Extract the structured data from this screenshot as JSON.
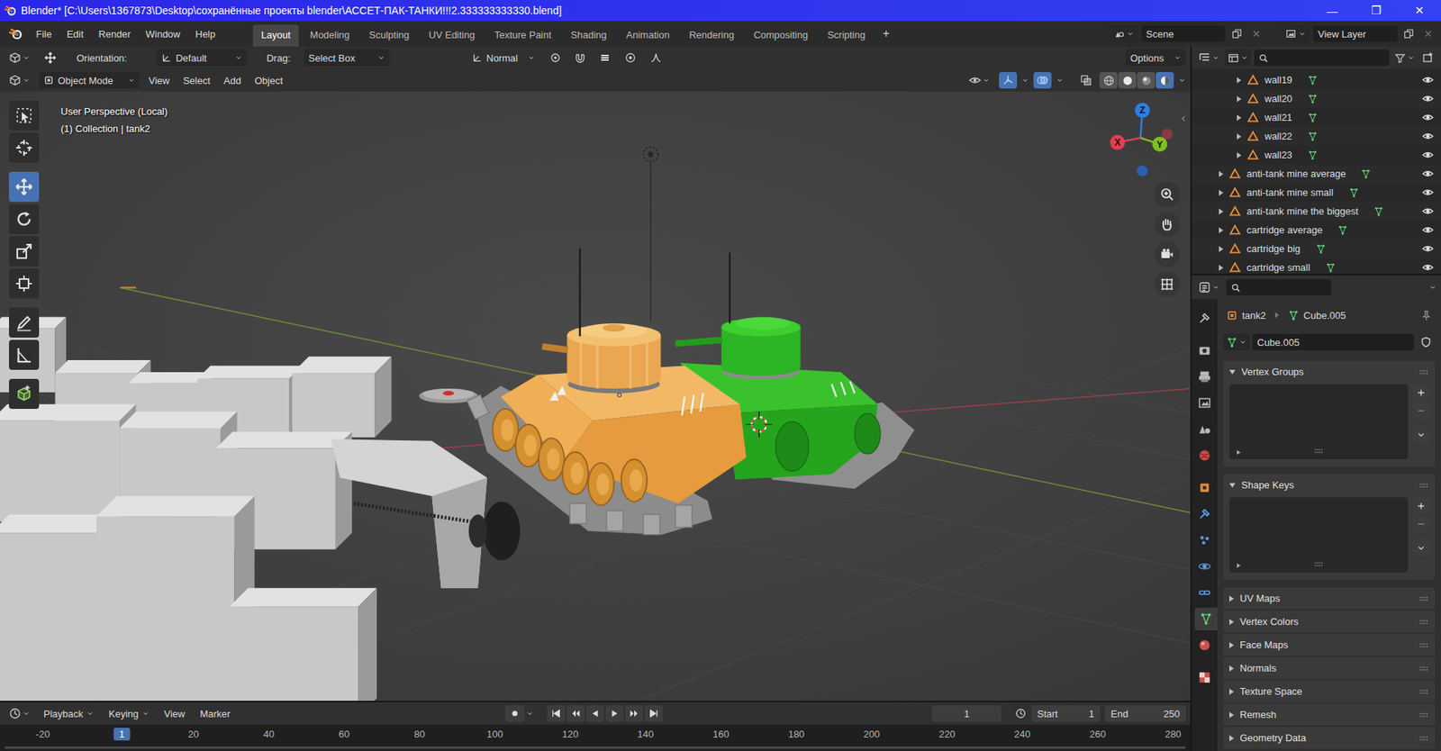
{
  "window": {
    "title": "Blender* [C:\\Users\\1367873\\Desktop\\сохранённые проекты blender\\АССЕТ-ПАК-ТАНКИ!!!2.333333333330.blend]",
    "controls": [
      "—",
      "❐",
      "✕"
    ]
  },
  "menu": [
    "File",
    "Edit",
    "Render",
    "Window",
    "Help"
  ],
  "workspaces": [
    {
      "label": "Layout",
      "selected": true
    },
    {
      "label": "Modeling",
      "selected": false
    },
    {
      "label": "Sculpting",
      "selected": false
    },
    {
      "label": "UV Editing",
      "selected": false
    },
    {
      "label": "Texture Paint",
      "selected": false
    },
    {
      "label": "Shading",
      "selected": false
    },
    {
      "label": "Animation",
      "selected": false
    },
    {
      "label": "Rendering",
      "selected": false
    },
    {
      "label": "Compositing",
      "selected": false
    },
    {
      "label": "Scripting",
      "selected": false
    }
  ],
  "add_workspace": "+",
  "scene": "Scene",
  "view_layer": "View Layer",
  "tool_settings": {
    "orientation_label": "Orientation:",
    "orientation": "Default",
    "drag_label": "Drag:",
    "drag": "Select Box",
    "pivot": "Normal",
    "options": "Options"
  },
  "viewport_header": {
    "mode": "Object Mode",
    "menus": [
      "View",
      "Select",
      "Add",
      "Object"
    ],
    "gizmos_on": true,
    "overlays_on": true,
    "shading": [
      {
        "kind": "wireframe",
        "selected": false
      },
      {
        "kind": "solid",
        "selected": false
      },
      {
        "kind": "material",
        "selected": false
      },
      {
        "kind": "rendered",
        "selected": true
      }
    ]
  },
  "toolbar": [
    {
      "kind": "select",
      "selected": false
    },
    {
      "kind": "cursor",
      "selected": false
    },
    {
      "kind": "move",
      "selected": true
    },
    {
      "kind": "rotate",
      "selected": false
    },
    {
      "kind": "scale",
      "selected": false
    },
    {
      "kind": "transform",
      "selected": false
    },
    {
      "kind": "annotate",
      "selected": false
    },
    {
      "kind": "measure",
      "selected": false
    },
    {
      "kind": "add-cube",
      "selected": false
    }
  ],
  "viewport": {
    "view_name": "User Perspective (Local)",
    "context": "(1) Collection | tank2",
    "axes": [
      {
        "label": "X",
        "color": "#e33d52"
      },
      {
        "label": "Y",
        "color": "#7fbf20"
      },
      {
        "label": "Z",
        "color": "#2d7ee8"
      }
    ]
  },
  "outliner": {
    "rows": [
      {
        "name": "wall19",
        "kind": "child",
        "expanded": false,
        "visible": true
      },
      {
        "name": "wall20",
        "kind": "child",
        "expanded": false,
        "visible": true
      },
      {
        "name": "wall21",
        "kind": "child",
        "expanded": false,
        "visible": true
      },
      {
        "name": "wall22",
        "kind": "child",
        "expanded": false,
        "visible": true
      },
      {
        "name": "wall23",
        "kind": "child",
        "expanded": false,
        "visible": true
      },
      {
        "name": "anti-tank mine average",
        "kind": "object",
        "expanded": false,
        "visible": true
      },
      {
        "name": "anti-tank mine small",
        "kind": "object",
        "expanded": false,
        "visible": true
      },
      {
        "name": "anti-tank mine the biggest",
        "kind": "object",
        "expanded": false,
        "visible": true
      },
      {
        "name": "cartridge average",
        "kind": "object",
        "expanded": false,
        "visible": true
      },
      {
        "name": "cartridge big",
        "kind": "object",
        "expanded": false,
        "visible": true
      },
      {
        "name": "cartridge small",
        "kind": "object",
        "expanded": false,
        "visible": true
      }
    ]
  },
  "properties": {
    "object": "tank2",
    "mesh": "Cube.005",
    "mesh_name": "Cube.005",
    "tabs": [
      {
        "kind": "tool",
        "selected": false
      },
      {
        "kind": "render",
        "selected": false
      },
      {
        "kind": "output",
        "selected": false
      },
      {
        "kind": "view-layer",
        "selected": false
      },
      {
        "kind": "scene",
        "selected": false
      },
      {
        "kind": "world",
        "selected": false
      },
      {
        "kind": "object",
        "selected": false
      },
      {
        "kind": "modifiers",
        "selected": false
      },
      {
        "kind": "particles",
        "selected": false
      },
      {
        "kind": "physics",
        "selected": false
      },
      {
        "kind": "constraints",
        "selected": false
      },
      {
        "kind": "data",
        "selected": true
      },
      {
        "kind": "material",
        "selected": false
      },
      {
        "kind": "texture",
        "selected": false
      }
    ],
    "sections": [
      {
        "title": "Vertex Groups",
        "expanded": true
      },
      {
        "title": "Shape Keys",
        "expanded": true
      },
      {
        "title": "UV Maps",
        "expanded": false
      },
      {
        "title": "Vertex Colors",
        "expanded": false
      },
      {
        "title": "Face Maps",
        "expanded": false
      },
      {
        "title": "Normals",
        "expanded": false
      },
      {
        "title": "Texture Space",
        "expanded": false
      },
      {
        "title": "Remesh",
        "expanded": false
      },
      {
        "title": "Geometry Data",
        "expanded": false
      }
    ]
  },
  "timeline": {
    "menus": [
      {
        "label": "Playback",
        "kind": "dropdown"
      },
      {
        "label": "Keying",
        "kind": "dropdown"
      },
      {
        "label": "View",
        "kind": "menu"
      },
      {
        "label": "Marker",
        "kind": "menu"
      }
    ],
    "frame": "1",
    "start_label": "Start",
    "start": "1",
    "end_label": "End",
    "end": "250",
    "ruler": [
      {
        "label": "-20",
        "selected": false
      },
      {
        "label": "1",
        "selected": true
      },
      {
        "label": "20",
        "selected": false
      },
      {
        "label": "40",
        "selected": false
      },
      {
        "label": "60",
        "selected": false
      },
      {
        "label": "80",
        "selected": false
      },
      {
        "label": "100",
        "selected": false
      },
      {
        "label": "120",
        "selected": false
      },
      {
        "label": "140",
        "selected": false
      },
      {
        "label": "160",
        "selected": false
      },
      {
        "label": "180",
        "selected": false
      },
      {
        "label": "200",
        "selected": false
      },
      {
        "label": "220",
        "selected": false
      },
      {
        "label": "240",
        "selected": false
      },
      {
        "label": "260",
        "selected": false
      },
      {
        "label": "280",
        "selected": false
      }
    ]
  }
}
